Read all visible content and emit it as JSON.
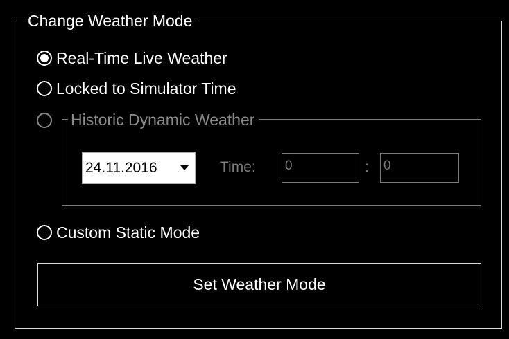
{
  "group": {
    "title": "Change Weather Mode"
  },
  "radios": [
    {
      "label": "Real-Time Live Weather",
      "checked": true,
      "enabled": true
    },
    {
      "label": "Locked to Simulator Time",
      "checked": false,
      "enabled": true
    },
    {
      "label": "Historic Dynamic Weather",
      "checked": false,
      "enabled": false
    },
    {
      "label": "Custom Static Mode",
      "checked": false,
      "enabled": true
    }
  ],
  "historic": {
    "date_value": "24.11.2016",
    "time_label": "Time:",
    "hour_value": "0",
    "separator": ":",
    "minute_value": "0"
  },
  "actions": {
    "set_label": "Set Weather Mode"
  },
  "colors": {
    "background": "#000000",
    "foreground": "#ffffff",
    "disabled": "#7a7a7a"
  }
}
